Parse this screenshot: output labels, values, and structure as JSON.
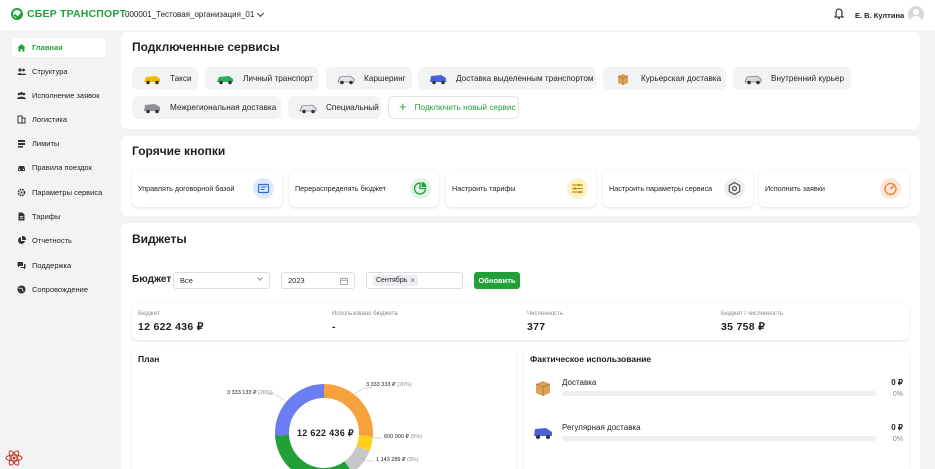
{
  "app": {
    "logo": "СБЕР ТРАНСПОРТ",
    "organization": "000001_Тестовая_организация_01",
    "user": "Е. В. Култина"
  },
  "sidebar": {
    "items": [
      {
        "label": "Главная",
        "icon": "home-icon"
      },
      {
        "label": "Структура",
        "icon": "users-icon"
      },
      {
        "label": "Исполнение заявок",
        "icon": "people-icon"
      },
      {
        "label": "Логистика",
        "icon": "logistics-icon"
      },
      {
        "label": "Лимиты",
        "icon": "limits-icon"
      },
      {
        "label": "Правила поездок",
        "icon": "car-icon"
      },
      {
        "label": "Параметры сервиса",
        "icon": "gear-icon"
      },
      {
        "label": "Тарифы",
        "icon": "document-icon"
      },
      {
        "label": "Отчетность",
        "icon": "pie-icon"
      },
      {
        "label": "Поддержка",
        "icon": "chat-icon"
      },
      {
        "label": "Сопровождение",
        "icon": "globe-icon"
      }
    ]
  },
  "services": {
    "title": "Подключенные сервисы",
    "items": [
      {
        "label": "Такси",
        "icon": "taxi-car-icon"
      },
      {
        "label": "Личный транспорт",
        "icon": "green-car-icon"
      },
      {
        "label": "Каршеринг",
        "icon": "carsharing-car-icon"
      },
      {
        "label": "Доставка выделенным транспортом",
        "icon": "van-icon"
      },
      {
        "label": "Курьерская доставка",
        "icon": "box-icon"
      },
      {
        "label": "Внутренний курьер",
        "icon": "courier-car-icon"
      },
      {
        "label": "Межрегиональная доставка",
        "icon": "truck-icon"
      },
      {
        "label": "Специальный",
        "icon": "special-car-icon"
      }
    ],
    "add_label": "Подключить новый сервис"
  },
  "hot_buttons": {
    "title": "Горячие кнопки",
    "items": [
      {
        "label": "Управлять договорной базой",
        "icon": "contract-icon",
        "color": "#dbe9fb"
      },
      {
        "label": "Перераспределять бюджет",
        "icon": "budget-pie-icon",
        "color": "#dff3e4"
      },
      {
        "label": "Настроить тарифы",
        "icon": "sliders-icon",
        "color": "#fdf2c7"
      },
      {
        "label": "Настроить параметры сервиса",
        "icon": "settings-icon",
        "color": "#eceef1"
      },
      {
        "label": "Исполнить заявки",
        "icon": "speedometer-icon",
        "color": "#fde6d6"
      }
    ]
  },
  "widgets": {
    "title": "Виджеты",
    "budget_label": "Бюджет",
    "filter_all": "Все",
    "filter_year": "2023",
    "filter_month": "Сентябрь",
    "refresh_label": "Обновить",
    "stats": [
      {
        "label": "Бюджет",
        "value": "12 622 436 ₽"
      },
      {
        "label": "Использовано бюджета",
        "value": "-"
      },
      {
        "label": "Численность",
        "value": "377"
      },
      {
        "label": "Бюджет / численность",
        "value": "35 758 ₽"
      }
    ]
  },
  "plan": {
    "title": "План",
    "total": "12 622 436 ₽",
    "segments": [
      {
        "label": "3 333 333 ₽",
        "pct": "(26%)",
        "share": 26,
        "color": "#f7a13c"
      },
      {
        "label": "600 000 ₽",
        "pct": "(5%)",
        "share": 5,
        "color": "#ffd11a"
      },
      {
        "label": "1 143 289 ₽",
        "pct": "(9%)",
        "share": 9,
        "color": "#c6c7cb"
      },
      {
        "label": "",
        "pct": "",
        "share": 34,
        "color": "#21a038"
      },
      {
        "label": "3 333 133 ₽",
        "pct": "(26%)",
        "share": 26,
        "color": "#6c7cf2"
      }
    ]
  },
  "usage": {
    "title": "Фактическое использование",
    "items": [
      {
        "label": "Доставка",
        "value": "0 ₽",
        "pct": "0%",
        "icon": "box-icon"
      },
      {
        "label": "Регулярная доставка",
        "value": "0 ₽",
        "pct": "0%",
        "icon": "van-icon"
      }
    ]
  }
}
